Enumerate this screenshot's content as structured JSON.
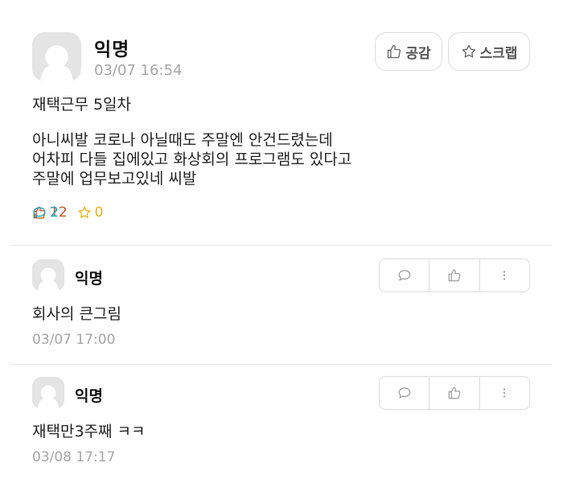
{
  "post": {
    "author": "익명",
    "time": "03/07 16:54",
    "like_button": "공감",
    "scrap_button": "스크랩",
    "title": "재택근무 5일차",
    "body_lines": [
      "아니씨발 코로나 아닐때도 주말엔 안건드렸는데",
      "어차피 다들 집에있고 화상회의 프로그램도 있다고",
      "주말에 업무보고있네 씨발"
    ],
    "stats": {
      "likes": "12",
      "comments": "2",
      "scraps": "0"
    },
    "colors": {
      "likes": "#c9542b",
      "comments": "#1ea4b8",
      "scraps": "#e8b51b"
    }
  },
  "comments": [
    {
      "author": "익명",
      "text": "회사의 큰그림",
      "time": "03/07 17:00"
    },
    {
      "author": "익명",
      "text": "재택만3주째 ㅋㅋ",
      "time": "03/08 17:17"
    }
  ],
  "icons": {
    "like": "thumbs-up-icon",
    "scrap": "star-icon",
    "comment": "speech-bubble-icon",
    "more": "vertical-dots-icon"
  }
}
